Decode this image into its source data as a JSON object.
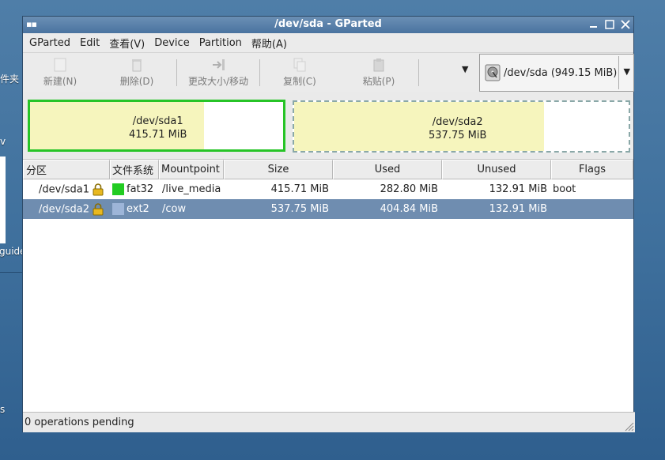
{
  "desktop": {
    "labels": [
      "件夹",
      "v",
      "guide",
      "s"
    ]
  },
  "window": {
    "title": "/dev/sda - GParted"
  },
  "menu": [
    {
      "label": "GParted",
      "mnemonic": "G"
    },
    {
      "label": "Edit",
      "mnemonic": "E"
    },
    {
      "label": "查看(V)",
      "mnemonic": "V"
    },
    {
      "label": "Device",
      "mnemonic": "D"
    },
    {
      "label": "Partition",
      "mnemonic": "P"
    },
    {
      "label": "帮助(A)",
      "mnemonic": "A"
    }
  ],
  "toolbar": {
    "new_label": "新建(N)",
    "delete_label": "删除(D)",
    "resize_label": "更改大小/移动",
    "copy_label": "复制(C)",
    "paste_label": "粘贴(P)",
    "device_label": "/dev/sda  (949.15 MiB)"
  },
  "map": {
    "partitions": [
      {
        "name": "/dev/sda1",
        "size": "415.71 MiB",
        "used_fraction": 0.68
      },
      {
        "name": "/dev/sda2",
        "size": "537.75 MiB",
        "used_fraction": 0.75
      }
    ]
  },
  "table": {
    "columns": [
      "分区",
      "文件系统",
      "Mountpoint",
      "Size",
      "Used",
      "Unused",
      "Flags"
    ],
    "rows": [
      {
        "partition": "/dev/sda1",
        "filesystem": "fat32",
        "fs_color": "#22cc22",
        "mountpoint": "/live_media",
        "size": "415.71 MiB",
        "used": "282.80 MiB",
        "unused": "132.91 MiB",
        "flags": "boot",
        "selected": false
      },
      {
        "partition": "/dev/sda2",
        "filesystem": "ext2",
        "fs_color": "#9db5d8",
        "mountpoint": "/cow",
        "size": "537.75 MiB",
        "used": "404.84 MiB",
        "unused": "132.91 MiB",
        "flags": "",
        "selected": true
      }
    ]
  },
  "status": {
    "text": "0 operations pending"
  },
  "colors": {
    "selected_row": "#6f8db0",
    "used_fill": "#f6f5bd",
    "active_border": "#27c427"
  }
}
